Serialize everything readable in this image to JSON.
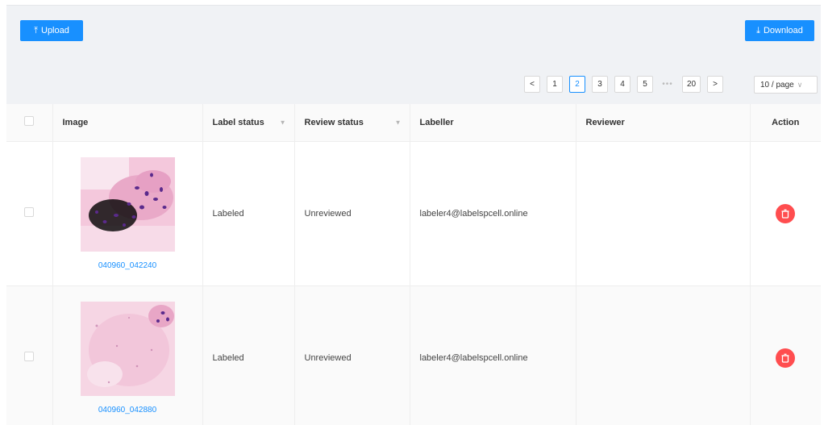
{
  "toolbar": {
    "upload_label": "Upload",
    "download_label": "Download"
  },
  "pagination": {
    "prev": "<",
    "next": ">",
    "pages": [
      "1",
      "2",
      "3",
      "4",
      "5"
    ],
    "ellipsis": "•••",
    "last": "20",
    "active": "2",
    "page_size": "10 / page"
  },
  "table": {
    "headers": {
      "image": "Image",
      "label_status": "Label status",
      "review_status": "Review status",
      "labeller": "Labeller",
      "reviewer": "Reviewer",
      "action": "Action"
    },
    "rows": [
      {
        "image_name": "040960_042240",
        "label_status": "Labeled",
        "review_status": "Unreviewed",
        "labeller": "labeler4@labelspcell.online",
        "reviewer": ""
      },
      {
        "image_name": "040960_042880",
        "label_status": "Labeled",
        "review_status": "Unreviewed",
        "labeller": "labeler4@labelspcell.online",
        "reviewer": ""
      }
    ]
  },
  "colors": {
    "primary": "#1890ff",
    "danger": "#ff4d4f"
  },
  "icons": {
    "upload": "upload-icon",
    "download": "download-icon",
    "filter": "filter-icon",
    "delete": "delete-icon",
    "dropdown": "chevron-down-icon"
  }
}
